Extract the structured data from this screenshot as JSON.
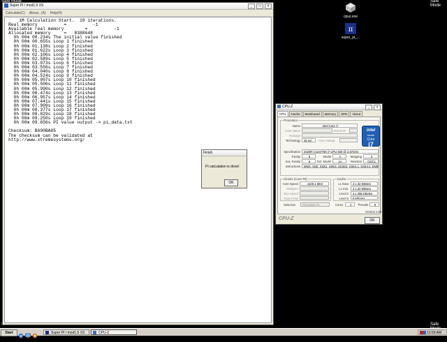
{
  "desktop": {
    "safe_mode": "Safe Mode",
    "icons": [
      {
        "label": "cpuz.exe"
      },
      {
        "label": "super_pi_..."
      }
    ]
  },
  "superpi": {
    "title": "Super PI / mod1.5 XS",
    "menu": [
      "Calculate(C)",
      "About...(A)",
      "Help(H)"
    ],
    "output": "    1M Calculation Start.  19 iterations.\nReal memory          =          -1\nAvailable real memory        =          -1\nAllocated memory     =   8388648\n  0h 00m 00.234s The initial value finished\n  0h 00m 00.655s Loop 1 finished\n  0h 00m 01.138s Loop 2 finished\n  0h 00m 01.622s Loop 3 finished\n  0h 00m 02.106s Loop 4 finished\n  0h 00m 02.589s Loop 5 finished\n  0h 00m 03.073s Loop 6 finished\n  0h 00m 03.556s Loop 7 finished\n  0h 00m 04.040s Loop 8 finished\n  0h 00m 04.524s Loop 9 finished\n  0h 00m 05.007s Loop 10 finished\n  0h 00m 05.506s Loop 11 finished\n  0h 00m 05.990s Loop 12 finished\n  0h 00m 06.474s Loop 13 finished\n  0h 00m 06.957s Loop 14 finished\n  0h 00m 07.441s Loop 15 finished\n  0h 00m 07.909s Loop 16 finished\n  0h 00m 08.377s Loop 17 finished\n  0h 00m 08.829s Loop 18 finished\n  0h 00m 09.250s Loop 19 finished\n  0h 00m 09.656s PI value output -> pi_data.txt\n\nChecksum: B690BA85\nThe checksum can be validated at\nhttp://www.xtremesystems.org/"
  },
  "finish": {
    "title": "Finish",
    "message": "PI calculation is done!",
    "ok": "OK"
  },
  "cpuz": {
    "title": "CPU-Z",
    "tabs": [
      "CPU",
      "Cache",
      "Mainboard",
      "Memory",
      "SPD",
      "About"
    ],
    "processor_group": "Processor",
    "name_label": "Name",
    "name_value": "Intel Core i7",
    "codename_label": "Code Name",
    "brandid_label": "Brand ID",
    "package_label": "Package",
    "technology_label": "Technology",
    "technology_value": "45 nm",
    "core_voltage_label": "Core Voltage",
    "specification_label": "Specification",
    "specification_value": "Intel(R) Core(TM) i7 CPU        920  @ 2.67GHz",
    "family_label": "Family",
    "family_value": "6",
    "model_label": "Model",
    "model_value": "A",
    "stepping_label": "Stepping",
    "stepping_value": "4",
    "extfamily_label": "Ext. Family",
    "extfamily_value": "6",
    "extmodel_label": "Ext. Model",
    "extmodel_value": "1A",
    "revision_label": "Revision",
    "revision_value": "C0/C1",
    "instructions_label": "Instructions",
    "instructions_value": "MMX, SSE, SSE2, SSE3, SSSE3, SSE4.1, SSE4.2, EM64T",
    "clocks_group": "Clocks (Core #0)",
    "core_speed_label": "Core Speed",
    "core_speed_value": "4100.1 MHz",
    "multiplier_label": "Multiplier",
    "bus_speed_label": "Bus Speed",
    "rated_fsb_label": "Rated FSB",
    "cache_group": "Cache",
    "l1d_label": "L1 Data",
    "l1d_value": "4 x 32 KBytes",
    "l1i_label": "L1 Inst.",
    "l1i_value": "4 x 32 KBytes",
    "l2_label": "Level 2",
    "l2_value": "4 x 256 KBytes",
    "l3_label": "Level 3",
    "l3_value": "8 MBytes",
    "selection_label": "Selection",
    "selection_value": "Processor #1",
    "cores_label": "Cores",
    "cores_value": "4",
    "threads_label": "Threads",
    "threads_value": "8",
    "version": "Version 1.50",
    "brand": "CPU-Z",
    "ok": "OK",
    "intel_logo": {
      "line1": "intel",
      "line2": "inside",
      "line3": "Core",
      "line4": "i7"
    }
  },
  "taskbar": {
    "start": "Start",
    "tasks": [
      "Super PI / mod1.5 XS",
      "CPU-Z"
    ],
    "clock": "12:59 AM"
  }
}
